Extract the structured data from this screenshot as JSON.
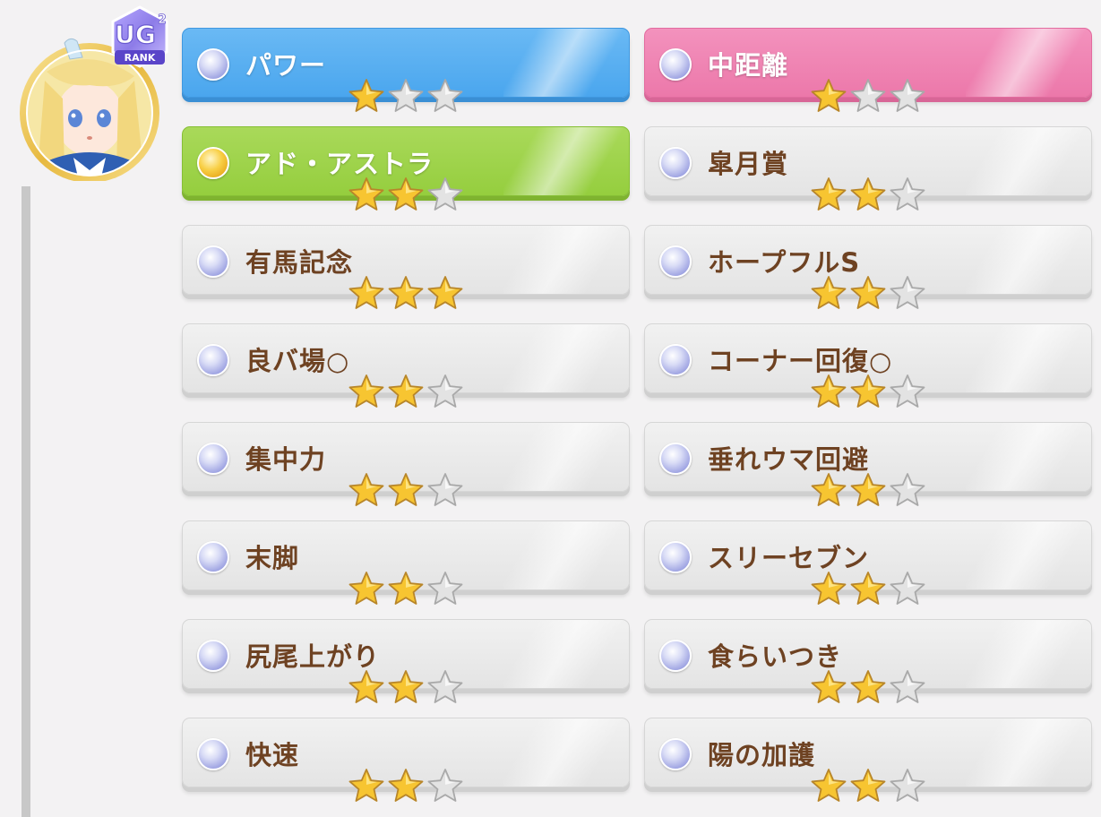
{
  "profile": {
    "avatar": "character-portrait",
    "rank_badge": {
      "letters": "UG",
      "superscript": "2",
      "caption": "RANK"
    }
  },
  "skills_left": [
    {
      "label": "パワー",
      "stars": 1,
      "color": "blue",
      "orb": "silver"
    },
    {
      "label": "アド・アストラ",
      "stars": 2,
      "color": "green",
      "orb": "gold"
    },
    {
      "label": "有馬記念",
      "stars": 3,
      "color": "gray",
      "orb": "silver"
    },
    {
      "label": "良バ場○",
      "stars": 2,
      "color": "gray",
      "orb": "silver"
    },
    {
      "label": "集中力",
      "stars": 2,
      "color": "gray",
      "orb": "silver"
    },
    {
      "label": "末脚",
      "stars": 2,
      "color": "gray",
      "orb": "silver"
    },
    {
      "label": "尻尾上がり",
      "stars": 2,
      "color": "gray",
      "orb": "silver"
    },
    {
      "label": "快速",
      "stars": 2,
      "color": "gray",
      "orb": "silver"
    }
  ],
  "skills_right": [
    {
      "label": "中距離",
      "stars": 1,
      "color": "pink",
      "orb": "silver"
    },
    {
      "label": "皐月賞",
      "stars": 2,
      "color": "gray",
      "orb": "silver"
    },
    {
      "label": "ホープフルS",
      "stars": 2,
      "color": "gray",
      "orb": "silver"
    },
    {
      "label": "コーナー回復○",
      "stars": 2,
      "color": "gray",
      "orb": "silver"
    },
    {
      "label": "垂れウマ回避",
      "stars": 2,
      "color": "gray",
      "orb": "silver"
    },
    {
      "label": "スリーセブン",
      "stars": 2,
      "color": "gray",
      "orb": "silver"
    },
    {
      "label": "食らいつき",
      "stars": 2,
      "color": "gray",
      "orb": "silver"
    },
    {
      "label": "陽の加護",
      "stars": 2,
      "color": "gray",
      "orb": "silver"
    }
  ],
  "star_max": 3,
  "colors": {
    "blue": "#4aa6ee",
    "pink": "#ec78aa",
    "green": "#95ce3e",
    "gray": "#e6e6e6",
    "label_brown": "#6e4222",
    "star_gold": "#f7c531",
    "star_empty": "#e3e3e3"
  }
}
